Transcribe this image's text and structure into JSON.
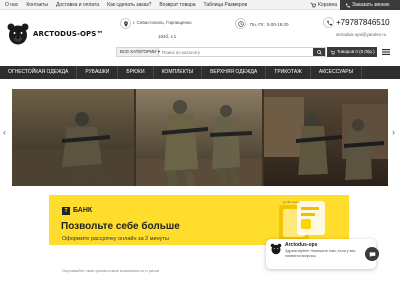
{
  "topbar": {
    "nav": [
      "О нас",
      "Контакты",
      "Доставка и оплата",
      "Как сделать заказ?",
      "Возврат товара",
      "Таблица Размеров"
    ],
    "cart_label": "Корзина",
    "callback_label": "Заказать звонок"
  },
  "header": {
    "logo_text": "ARCTODUS-OPS™",
    "address_line1": "г. Севастополь, Горпищенко",
    "address_line2": "104б, к 1",
    "hours": "Пн.-Пт.: 9.00-18.00",
    "phone": "+79787846510",
    "email": "arctodus-ops@yandex.ru"
  },
  "search": {
    "category_label": "ВСЕ КАТЕГОРИИ ▾",
    "placeholder": "Поиск по каталогу",
    "cart_button": "Товаров 0 (0.00р.)"
  },
  "categories": [
    "Огнестойкая одежда",
    "Рубашки",
    "Брюки",
    "Комплекты",
    "Верхняя одежда",
    "Трикотаж",
    "Аксессуары"
  ],
  "banner": {
    "bank_logo": "T",
    "bank_name": "БАНК",
    "title": "Позвольте себе больше",
    "subtitle": "Оформите рассрочку онлайн за 2 минуты",
    "note": "до 36 тысяч",
    "below_text": "Оценивайте свои финансовые возможности и риски"
  },
  "chat": {
    "name": "Arctodus-ops",
    "message": "Здравствуйте! Напишите нам, если у вас появятся вопросы."
  },
  "colors": {
    "dark": "#2e2e2e",
    "banner_yellow": "#ffdd2d",
    "hero_bg": "#3d3226"
  }
}
